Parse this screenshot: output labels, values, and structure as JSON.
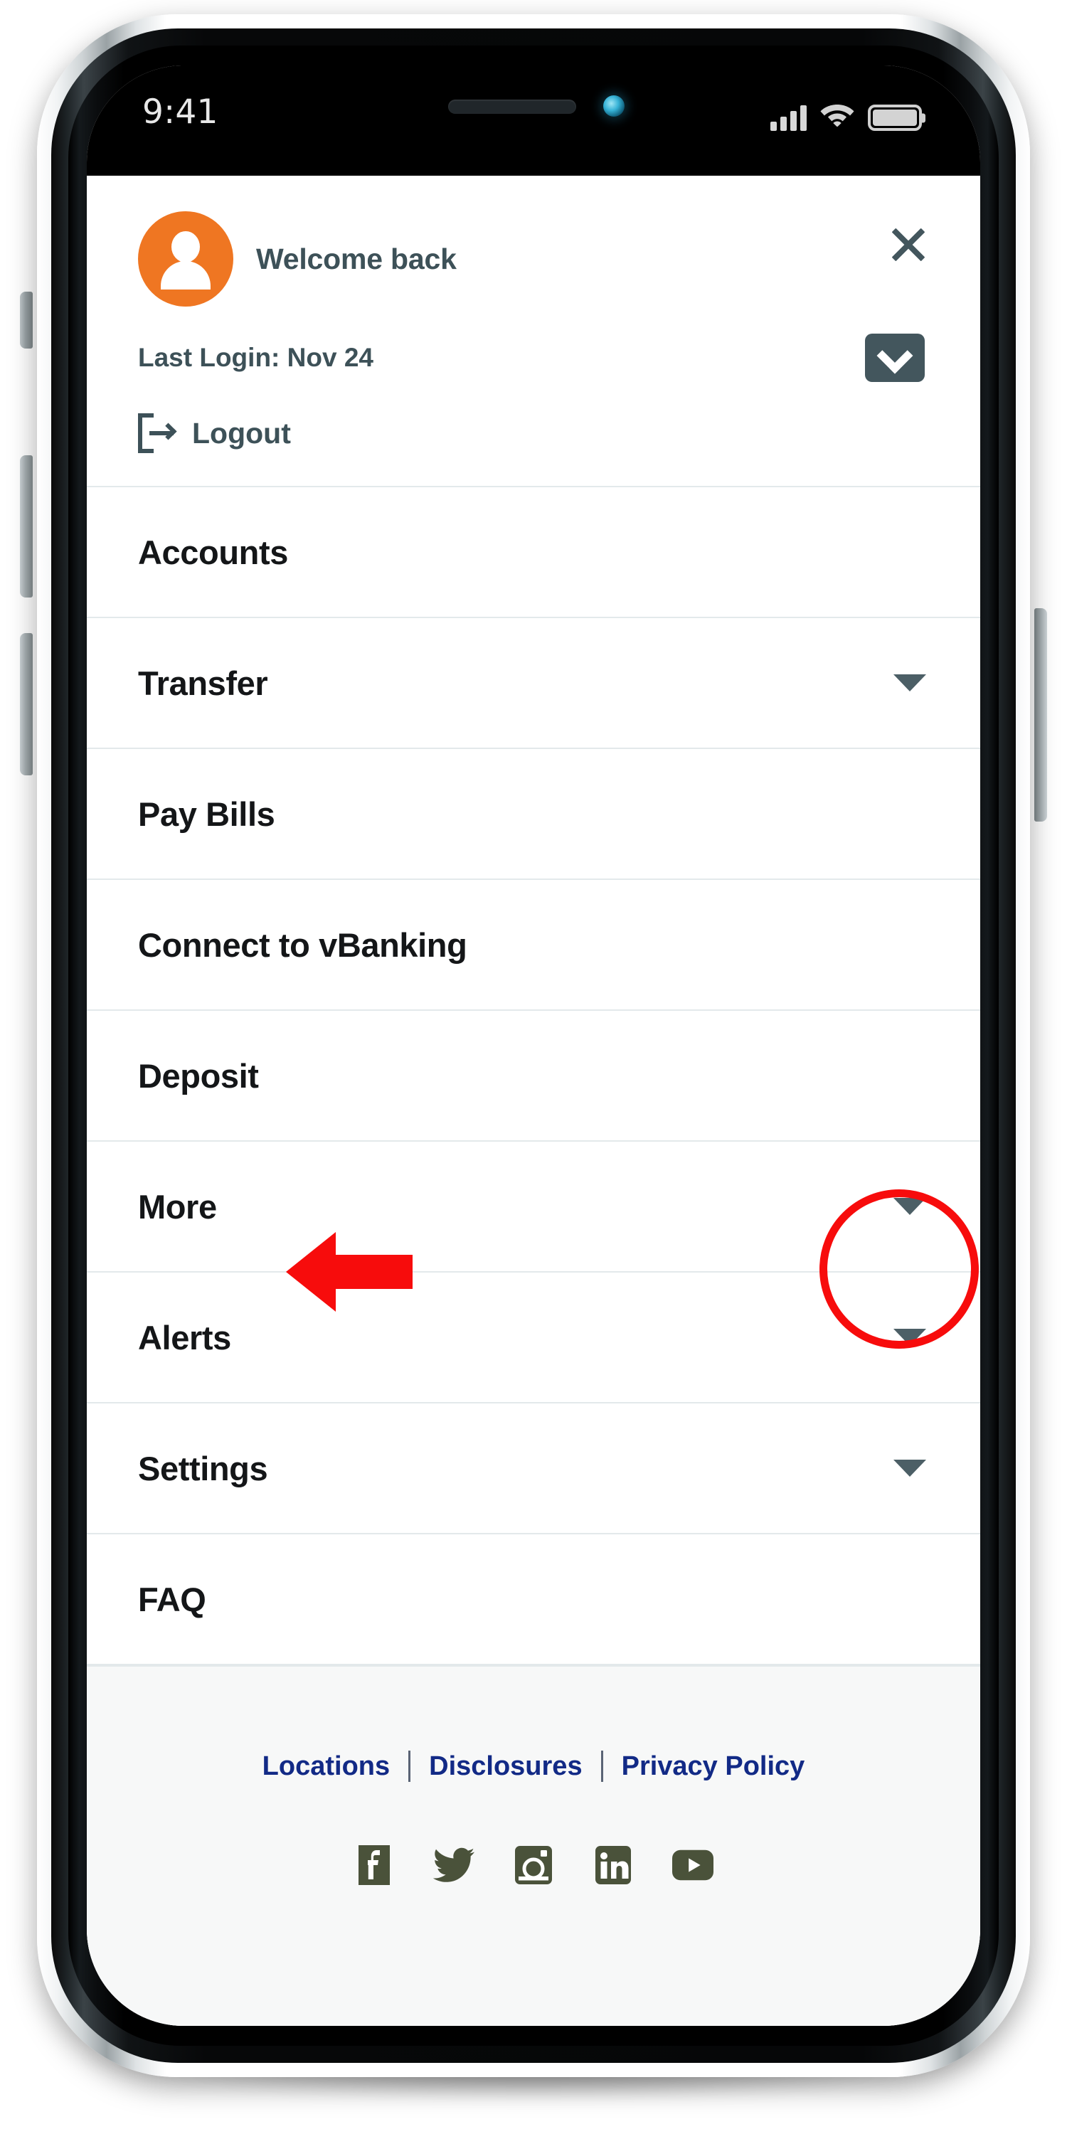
{
  "status_bar": {
    "time": "9:41",
    "signal_icon": "cellular-signal-icon",
    "wifi_icon": "wifi-icon",
    "battery_icon": "battery-icon"
  },
  "header": {
    "avatar_icon": "user-avatar-icon",
    "welcome_text": "Welcome back",
    "close_icon": "close-icon",
    "last_login": "Last Login: Nov 24",
    "mail_icon": "envelope-icon",
    "logout_icon": "logout-icon",
    "logout_label": "Logout"
  },
  "menu": {
    "items": [
      {
        "label": "Accounts",
        "has_caret": false
      },
      {
        "label": "Transfer",
        "has_caret": true
      },
      {
        "label": "Pay Bills",
        "has_caret": false
      },
      {
        "label": "Connect to vBanking",
        "has_caret": false
      },
      {
        "label": "Deposit",
        "has_caret": false
      },
      {
        "label": "More",
        "has_caret": true
      },
      {
        "label": "Alerts",
        "has_caret": true
      },
      {
        "label": "Settings",
        "has_caret": true
      },
      {
        "label": "FAQ",
        "has_caret": false
      }
    ]
  },
  "footer": {
    "links": [
      "Locations",
      "Disclosures",
      "Privacy Policy"
    ],
    "separator": "|",
    "social": [
      {
        "name": "facebook-icon",
        "label": "Facebook"
      },
      {
        "name": "twitter-icon",
        "label": "Twitter"
      },
      {
        "name": "instagram-icon",
        "label": "Instagram"
      },
      {
        "name": "linkedin-icon",
        "label": "LinkedIn"
      },
      {
        "name": "youtube-icon",
        "label": "YouTube"
      }
    ]
  },
  "annotations": {
    "arrow": {
      "target": "More",
      "direction": "left",
      "color": "#f70c0c"
    },
    "circle": {
      "target": "More dropdown caret",
      "color": "#f70c0c"
    }
  },
  "colors": {
    "brand_orange": "#ef7622",
    "slate": "#3d5158",
    "link_navy": "#122a86",
    "social_olive": "#4a523a",
    "annotation_red": "#f70c0c",
    "divider": "#e3e9eb",
    "footer_bg": "#f7f8f8"
  }
}
